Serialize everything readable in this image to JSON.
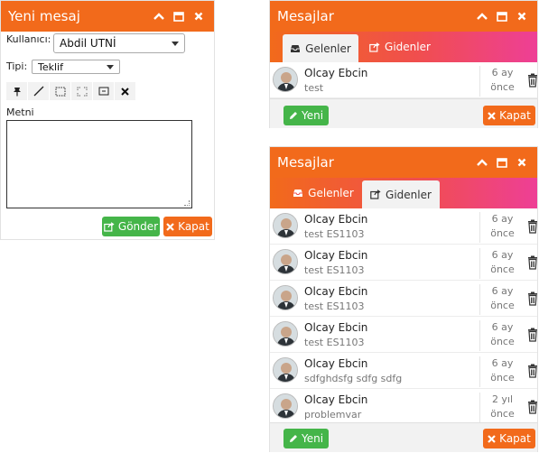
{
  "compose": {
    "title": "Yeni mesaj",
    "user_label": "Kullanıcı:",
    "user_value": "Abdil UTNİ",
    "type_label": "Tipi:",
    "type_value": "Teklif",
    "body_label": "Metni",
    "body_value": "",
    "send_label": "Gönder",
    "close_label": "Kapat"
  },
  "inbox_window": {
    "title": "Mesajlar",
    "tabs": [
      {
        "label": "Gelenler",
        "active": true
      },
      {
        "label": "Gidenler",
        "active": false
      }
    ],
    "messages": [
      {
        "name": "Olcay Ebcin",
        "subject": "test",
        "time_num": "6 ay",
        "time_unit": "önce"
      }
    ],
    "new_label": "Yeni",
    "close_label": "Kapat"
  },
  "outbox_window": {
    "title": "Mesajlar",
    "tabs": [
      {
        "label": "Gelenler",
        "active": false
      },
      {
        "label": "Gidenler",
        "active": true
      }
    ],
    "messages": [
      {
        "name": "Olcay Ebcin",
        "subject": "test ES1103",
        "time_num": "6 ay",
        "time_unit": "önce"
      },
      {
        "name": "Olcay Ebcin",
        "subject": "test ES1103",
        "time_num": "6 ay",
        "time_unit": "önce"
      },
      {
        "name": "Olcay Ebcin",
        "subject": "test ES1103",
        "time_num": "6 ay",
        "time_unit": "önce"
      },
      {
        "name": "Olcay Ebcin",
        "subject": "test ES1103",
        "time_num": "6 ay",
        "time_unit": "önce"
      },
      {
        "name": "Olcay Ebcin",
        "subject": "sdfghdsfg sdfg sdfg",
        "time_num": "6 ay",
        "time_unit": "önce"
      },
      {
        "name": "Olcay Ebcin",
        "subject": "problemvar",
        "time_num": "2 yıl",
        "time_unit": "önce"
      }
    ],
    "new_label": "Yeni",
    "close_label": "Kapat"
  },
  "colors": {
    "accent": "#f26a1b",
    "success": "#45b549",
    "gradient_end": "#ee3f96"
  },
  "icons": [
    "chevron-up-icon",
    "maximize-icon",
    "close-icon",
    "pin-icon",
    "line-icon",
    "rectangle-select-icon",
    "fullscreen-icon",
    "frame-icon",
    "clear-icon",
    "inbox-icon",
    "share-icon",
    "pencil-icon",
    "trash-icon"
  ]
}
